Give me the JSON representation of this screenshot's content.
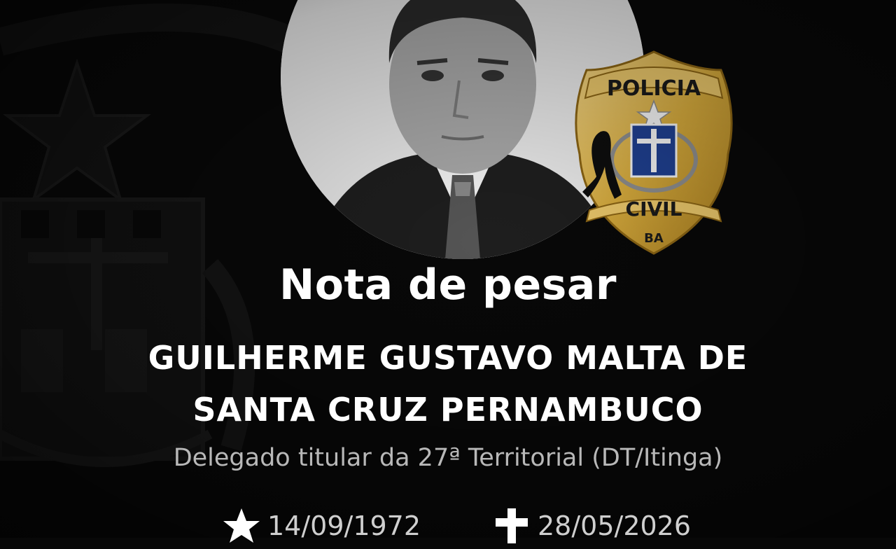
{
  "badge": {
    "top_text": "POLICIA",
    "bottom_text": "CIVIL",
    "state": "BA"
  },
  "title": "Nota de pesar",
  "name_line1": "GUILHERME GUSTAVO MALTA DE",
  "name_line2": "SANTA CRUZ PERNAMBUCO",
  "role": "Delegado titular da 27ª Territorial (DT/Itinga)",
  "birth": {
    "icon": "star-icon",
    "date": "14/09/1972"
  },
  "death": {
    "icon": "cross-icon",
    "date": "28/05/2026"
  },
  "colors": {
    "background": "#080808",
    "text": "#ffffff",
    "subtitle": "#b8b8b8",
    "badge_gold": "#d4a93c",
    "badge_blue": "#1f3f8f"
  }
}
